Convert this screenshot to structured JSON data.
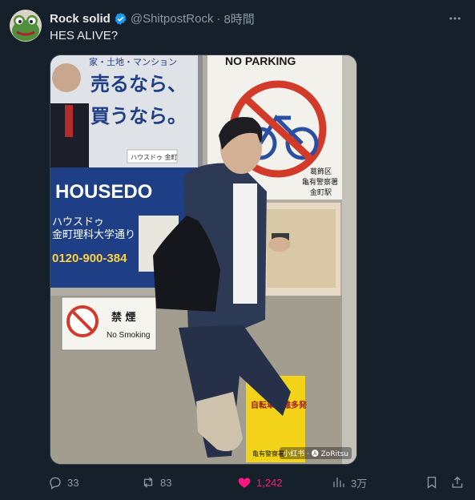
{
  "post": {
    "display_name": "Rock solid",
    "handle": "@ShitpostRock",
    "separator": "·",
    "time": "8時間",
    "text": "HES ALIVE?",
    "more_icon": "more-icon",
    "verified_color": "#1d9bf0"
  },
  "media": {
    "watermark": "小红书  · 🅐 ZoRitsu",
    "signs": {
      "no_parking": "NO PARKING",
      "police_1": "葛飾区",
      "police_2": "亀有警察署",
      "police_3": "金町駅",
      "ad_line1": "家・土地・マンション",
      "ad_line2": "売るなら、",
      "ad_line3": "買うなら。",
      "ad_brand": "HOUSEDO",
      "ad_katakana": "ハウスドゥ",
      "ad_store": "金町理科大学通り",
      "ad_phone": "0120-900-384",
      "ad_small": "ハウスドゥ 金町",
      "no_smoking_jp": "禁 煙",
      "no_smoking_en": "No Smoking",
      "notice_title": "自転車盗難多発",
      "notice_small": "亀有警察署"
    }
  },
  "actions": {
    "reply_count": "33",
    "retweet_count": "83",
    "like_count": "1,242",
    "views_count": "3万",
    "like_color": "#f91880"
  }
}
